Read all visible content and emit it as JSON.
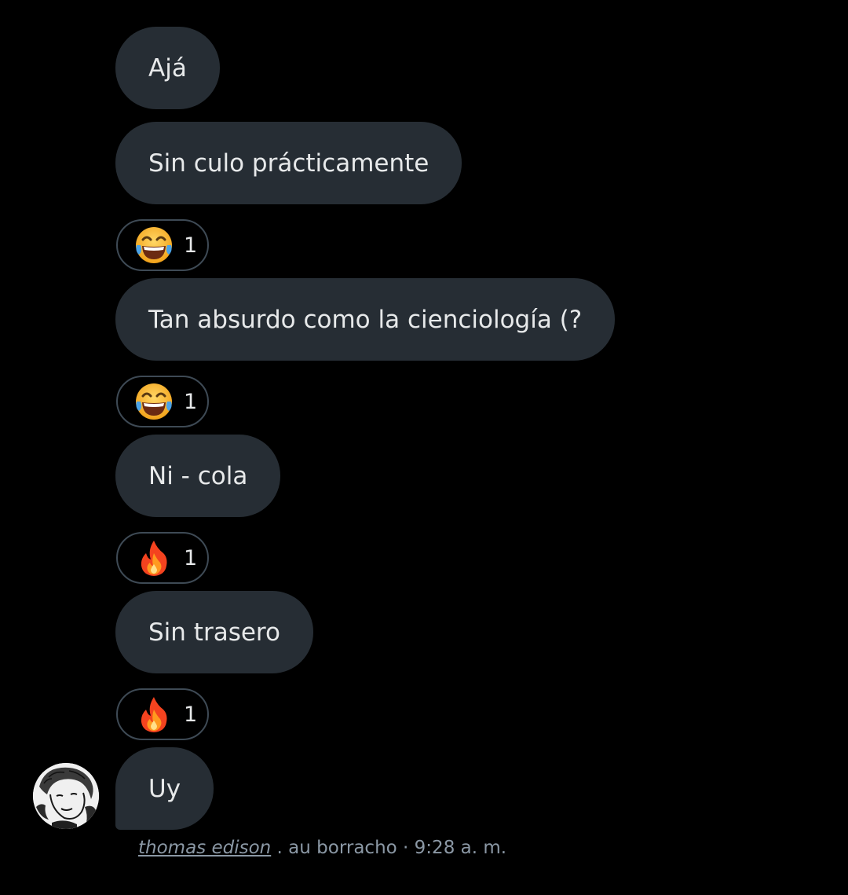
{
  "messages": [
    {
      "text": "Ajá"
    },
    {
      "text": "Sin culo prácticamente",
      "reaction": {
        "emoji": "face-with-tears-of-joy",
        "count": "1"
      }
    },
    {
      "text": "Tan absurdo como la cienciología (?",
      "reaction": {
        "emoji": "face-with-tears-of-joy",
        "count": "1"
      }
    },
    {
      "text": "Ni - cola",
      "reaction": {
        "emoji": "fire",
        "count": "1"
      }
    },
    {
      "text": "Sin trasero",
      "reaction": {
        "emoji": "fire",
        "count": "1"
      }
    },
    {
      "text": "Uy"
    }
  ],
  "footer": {
    "sender": "thomas edison",
    "separator": ".",
    "sender_label": "au borracho",
    "dot": "·",
    "time": "9:28 a. m."
  },
  "colors": {
    "background": "#000000",
    "bubble": "#262d34",
    "text": "#e7e9ea",
    "reaction_border": "#3e4a55",
    "meta": "#8b98a5"
  }
}
